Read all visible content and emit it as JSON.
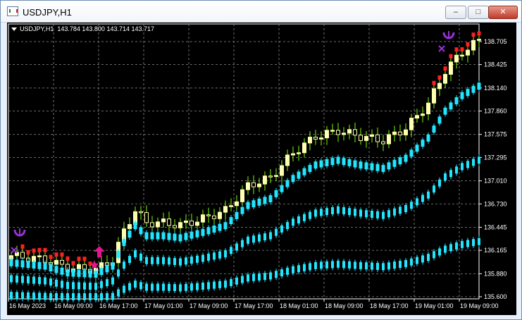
{
  "window": {
    "title": "USDJPY,H1",
    "buttons": {
      "minimize": "–",
      "maximize": "□",
      "close": "✕"
    }
  },
  "chart_header": {
    "symbol": "USDJPY,H1",
    "ohlc": "143.784 143.800 143.714 143.717"
  },
  "chart_data": {
    "type": "candlestick",
    "price_axis_labels": [
      "138.705",
      "138.425",
      "138.140",
      "137.860",
      "137.575",
      "137.295",
      "137.010",
      "136.730",
      "136.445",
      "136.165",
      "135.880",
      "135.600"
    ],
    "time_axis_labels": [
      "16 May 2023",
      "16 May 09:00",
      "16 May 17:00",
      "17 May 01:00",
      "17 May 09:00",
      "17 May 17:00",
      "18 May 01:00",
      "18 May 09:00",
      "18 May 17:00",
      "19 May 01:00",
      "19 May 09:00"
    ],
    "ylim": [
      135.6,
      138.705
    ],
    "grid": true,
    "colors": {
      "background": "#000000",
      "grid": "#8c8c8c",
      "bull_candle": "#ffffb0",
      "bear_candle": "#ffffb0",
      "wick": "#7cfc00",
      "band": "#22e6ff",
      "trail_red": "#ff2020",
      "signal_magenta": "#e0178c",
      "signal_purple": "#9b30d9"
    }
  }
}
